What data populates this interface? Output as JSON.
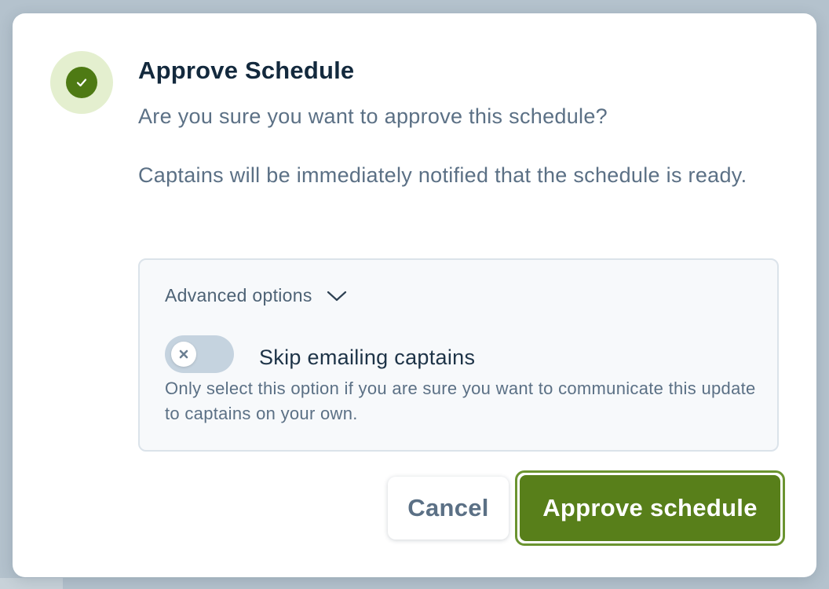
{
  "dialog": {
    "title": "Approve Schedule",
    "question": "Are you sure you want to approve this schedule?",
    "notice": "Captains will be immediately notified that the schedule is ready.",
    "status_icon": "check-icon"
  },
  "advanced": {
    "label": "Advanced options",
    "expand_icon": "chevron-down-icon",
    "skip_emails": {
      "label": "Skip emailing captains",
      "help": "Only select this option if you are sure you want to communicate this update to captains on your own.",
      "enabled": false,
      "knob_icon": "close-icon"
    }
  },
  "actions": {
    "cancel_label": "Cancel",
    "approve_label": "Approve schedule"
  },
  "colors": {
    "accent": "#587f1a",
    "accent_light": "#e4efcf",
    "toggle_off": "#c5d3df"
  }
}
